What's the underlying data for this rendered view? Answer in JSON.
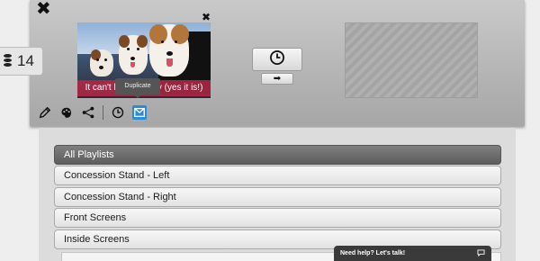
{
  "counter": {
    "value": "14",
    "icon": "database-icon"
  },
  "slide": {
    "caption": "It can't be this easy (yes it is!)",
    "close_icon": "close-icon"
  },
  "tooltip": {
    "text": "Duplicate"
  },
  "toolbar": {
    "icons": [
      "pencil-icon",
      "palette-icon",
      "share-icon",
      "clock-icon",
      "duplicate-icon"
    ],
    "active_color": "#2a8bd6"
  },
  "schedule": {
    "clock_icon": "clock-icon",
    "arrow": "➡"
  },
  "playlists": {
    "header": "All Playlists",
    "items": [
      "Concession Stand - Left",
      "Concession Stand - Right",
      "Front Screens",
      "Inside Screens"
    ]
  },
  "help": {
    "text": "Need help? Let's talk!",
    "icon": "chat-icon"
  }
}
